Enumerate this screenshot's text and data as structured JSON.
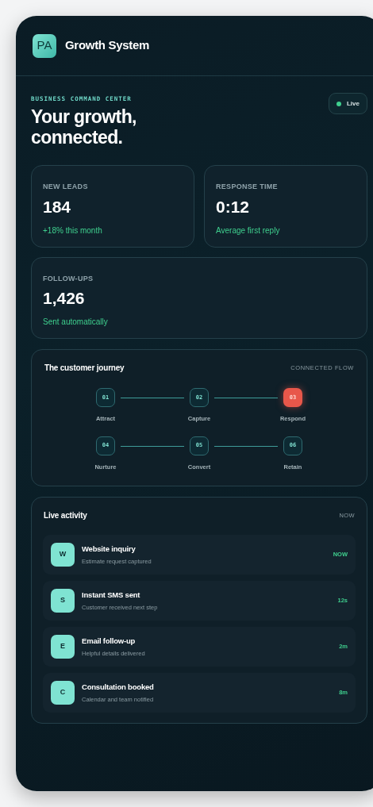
{
  "header": {
    "logo": "PA",
    "title": "Growth System"
  },
  "hero": {
    "eyebrow": "BUSINESS COMMAND CENTER",
    "title_lines": [
      "Your growth,",
      "connected."
    ],
    "status": {
      "label": "Live",
      "on": true
    }
  },
  "stats": [
    {
      "label": "NEW LEADS",
      "value": "184",
      "note": "+18% this month"
    },
    {
      "label": "RESPONSE TIME",
      "value": "0:12",
      "note": "Average first reply"
    },
    {
      "label": "FOLLOW-UPS",
      "value": "1,426",
      "note": "Sent automatically"
    }
  ],
  "journey": {
    "title": "The customer journey",
    "caption": "CONNECTED FLOW",
    "steps": [
      {
        "number": "01",
        "label": "Attract",
        "selected": false
      },
      {
        "number": "02",
        "label": "Capture",
        "selected": false
      },
      {
        "number": "03",
        "label": "Respond",
        "selected": true
      },
      {
        "number": "04",
        "label": "Nurture",
        "selected": false
      },
      {
        "number": "05",
        "label": "Convert",
        "selected": false
      },
      {
        "number": "06",
        "label": "Retain",
        "selected": false
      }
    ]
  },
  "activity": {
    "title": "Live activity",
    "caption": "NOW",
    "items": [
      {
        "initial": "W",
        "title": "Website inquiry",
        "subtitle": "Estimate request captured",
        "time": "NOW"
      },
      {
        "initial": "S",
        "title": "Instant SMS sent",
        "subtitle": "Customer received next step",
        "time": "12s"
      },
      {
        "initial": "E",
        "title": "Email follow-up",
        "subtitle": "Helpful details delivered",
        "time": "2m"
      },
      {
        "initial": "C",
        "title": "Consultation booked",
        "subtitle": "Calendar and team notified",
        "time": "8m"
      }
    ]
  }
}
